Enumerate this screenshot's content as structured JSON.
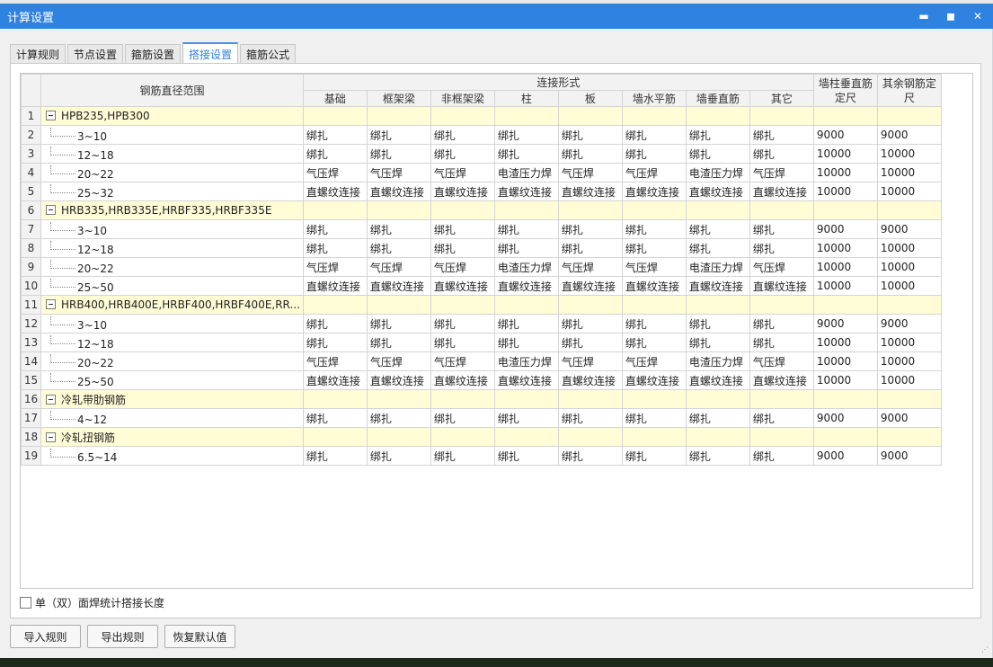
{
  "window": {
    "title": "计算设置"
  },
  "tabs": [
    {
      "label": "计算规则",
      "active": false
    },
    {
      "label": "节点设置",
      "active": false
    },
    {
      "label": "箍筋设置",
      "active": false
    },
    {
      "label": "搭接设置",
      "active": true
    },
    {
      "label": "箍筋公式",
      "active": false
    }
  ],
  "grid": {
    "header_range": "钢筋直径范围",
    "header_connection": "连接形式",
    "header_wall_col": "墙柱垂直筋定尺",
    "header_other": "其余钢筋定尺",
    "sub_headers": [
      "基础",
      "框架梁",
      "非框架梁",
      "柱",
      "板",
      "墙水平筋",
      "墙垂直筋",
      "其它"
    ],
    "rows": [
      {
        "n": "1",
        "group": true,
        "label": "HPB235,HPB300",
        "cells": [
          "",
          "",
          "",
          "",
          "",
          "",
          "",
          "",
          "",
          ""
        ]
      },
      {
        "n": "2",
        "group": false,
        "label": "3~10",
        "cells": [
          "绑扎",
          "绑扎",
          "绑扎",
          "绑扎",
          "绑扎",
          "绑扎",
          "绑扎",
          "绑扎",
          "9000",
          "9000"
        ]
      },
      {
        "n": "3",
        "group": false,
        "label": "12~18",
        "cells": [
          "绑扎",
          "绑扎",
          "绑扎",
          "绑扎",
          "绑扎",
          "绑扎",
          "绑扎",
          "绑扎",
          "10000",
          "10000"
        ]
      },
      {
        "n": "4",
        "group": false,
        "label": "20~22",
        "cells": [
          "气压焊",
          "气压焊",
          "气压焊",
          "电渣压力焊",
          "气压焊",
          "气压焊",
          "电渣压力焊",
          "气压焊",
          "10000",
          "10000"
        ]
      },
      {
        "n": "5",
        "group": false,
        "label": "25~32",
        "cells": [
          "直螺纹连接",
          "直螺纹连接",
          "直螺纹连接",
          "直螺纹连接",
          "直螺纹连接",
          "直螺纹连接",
          "直螺纹连接",
          "直螺纹连接",
          "10000",
          "10000"
        ]
      },
      {
        "n": "6",
        "group": true,
        "label": "HRB335,HRB335E,HRBF335,HRBF335E",
        "cells": [
          "",
          "",
          "",
          "",
          "",
          "",
          "",
          "",
          "",
          ""
        ]
      },
      {
        "n": "7",
        "group": false,
        "label": "3~10",
        "cells": [
          "绑扎",
          "绑扎",
          "绑扎",
          "绑扎",
          "绑扎",
          "绑扎",
          "绑扎",
          "绑扎",
          "9000",
          "9000"
        ]
      },
      {
        "n": "8",
        "group": false,
        "label": "12~18",
        "cells": [
          "绑扎",
          "绑扎",
          "绑扎",
          "绑扎",
          "绑扎",
          "绑扎",
          "绑扎",
          "绑扎",
          "10000",
          "10000"
        ]
      },
      {
        "n": "9",
        "group": false,
        "label": "20~22",
        "cells": [
          "气压焊",
          "气压焊",
          "气压焊",
          "电渣压力焊",
          "气压焊",
          "气压焊",
          "电渣压力焊",
          "气压焊",
          "10000",
          "10000"
        ]
      },
      {
        "n": "10",
        "group": false,
        "label": "25~50",
        "cells": [
          "直螺纹连接",
          "直螺纹连接",
          "直螺纹连接",
          "直螺纹连接",
          "直螺纹连接",
          "直螺纹连接",
          "直螺纹连接",
          "直螺纹连接",
          "10000",
          "10000"
        ]
      },
      {
        "n": "11",
        "group": true,
        "label": "HRB400,HRB400E,HRBF400,HRBF400E,RR...",
        "cells": [
          "",
          "",
          "",
          "",
          "",
          "",
          "",
          "",
          "",
          ""
        ]
      },
      {
        "n": "12",
        "group": false,
        "label": "3~10",
        "cells": [
          "绑扎",
          "绑扎",
          "绑扎",
          "绑扎",
          "绑扎",
          "绑扎",
          "绑扎",
          "绑扎",
          "9000",
          "9000"
        ]
      },
      {
        "n": "13",
        "group": false,
        "label": "12~18",
        "cells": [
          "绑扎",
          "绑扎",
          "绑扎",
          "绑扎",
          "绑扎",
          "绑扎",
          "绑扎",
          "绑扎",
          "10000",
          "10000"
        ]
      },
      {
        "n": "14",
        "group": false,
        "label": "20~22",
        "cells": [
          "气压焊",
          "气压焊",
          "气压焊",
          "电渣压力焊",
          "气压焊",
          "气压焊",
          "电渣压力焊",
          "气压焊",
          "10000",
          "10000"
        ]
      },
      {
        "n": "15",
        "group": false,
        "label": "25~50",
        "cells": [
          "直螺纹连接",
          "直螺纹连接",
          "直螺纹连接",
          "直螺纹连接",
          "直螺纹连接",
          "直螺纹连接",
          "直螺纹连接",
          "直螺纹连接",
          "10000",
          "10000"
        ]
      },
      {
        "n": "16",
        "group": true,
        "label": "冷轧带肋钢筋",
        "cells": [
          "",
          "",
          "",
          "",
          "",
          "",
          "",
          "",
          "",
          ""
        ]
      },
      {
        "n": "17",
        "group": false,
        "label": "4~12",
        "cells": [
          "绑扎",
          "绑扎",
          "绑扎",
          "绑扎",
          "绑扎",
          "绑扎",
          "绑扎",
          "绑扎",
          "9000",
          "9000"
        ]
      },
      {
        "n": "18",
        "group": true,
        "label": "冷轧扭钢筋",
        "cells": [
          "",
          "",
          "",
          "",
          "",
          "",
          "",
          "",
          "",
          ""
        ]
      },
      {
        "n": "19",
        "group": false,
        "label": "6.5~14",
        "cells": [
          "绑扎",
          "绑扎",
          "绑扎",
          "绑扎",
          "绑扎",
          "绑扎",
          "绑扎",
          "绑扎",
          "9000",
          "9000"
        ]
      }
    ]
  },
  "footer": {
    "checkbox_label": "单（双）面焊统计搭接长度",
    "buttons": [
      "导入规则",
      "导出规则",
      "恢复默认值"
    ]
  }
}
